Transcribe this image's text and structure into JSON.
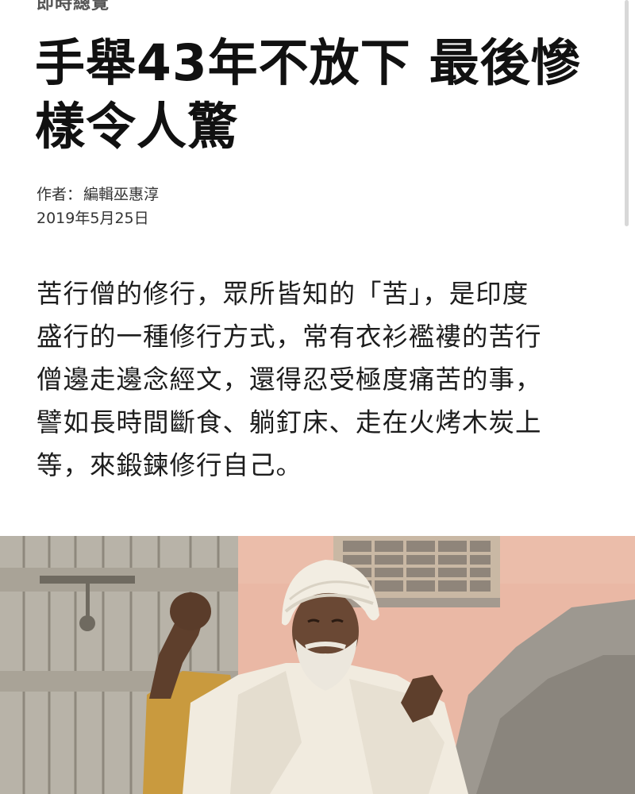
{
  "header": {
    "section_label": "即時總覽"
  },
  "article": {
    "headline_line1": "手舉43年不放下 最後慘",
    "headline_line2": "樣令人驚",
    "author_prefix": "作者：",
    "author_name": "編輯巫惠淳",
    "date": "2019年5月25日",
    "body_lines": [
      "苦行僧的修行，眾所皆知的「苦」，是印度",
      "盛行的一種修行方式，常有衣衫襤褸的苦行",
      "僧邊走邊念經文，還得忍受極度痛苦的事，",
      "譬如長時間斷食、躺釘床、走在火烤木炭上",
      "等，來鍛鍊修行自己。"
    ]
  },
  "photo": {
    "subject": "elderly sadhu in white turban raising arm in front of weathered wooden door and pink wall",
    "colors": {
      "door": "#b9b3a6",
      "wall": "#e8b9a8",
      "turban": "#f2ede2",
      "robe": "#f1ebdf",
      "skin": "#6b4a35",
      "rubble": "#9e9a92",
      "shirt": "#c99a3e"
    }
  }
}
